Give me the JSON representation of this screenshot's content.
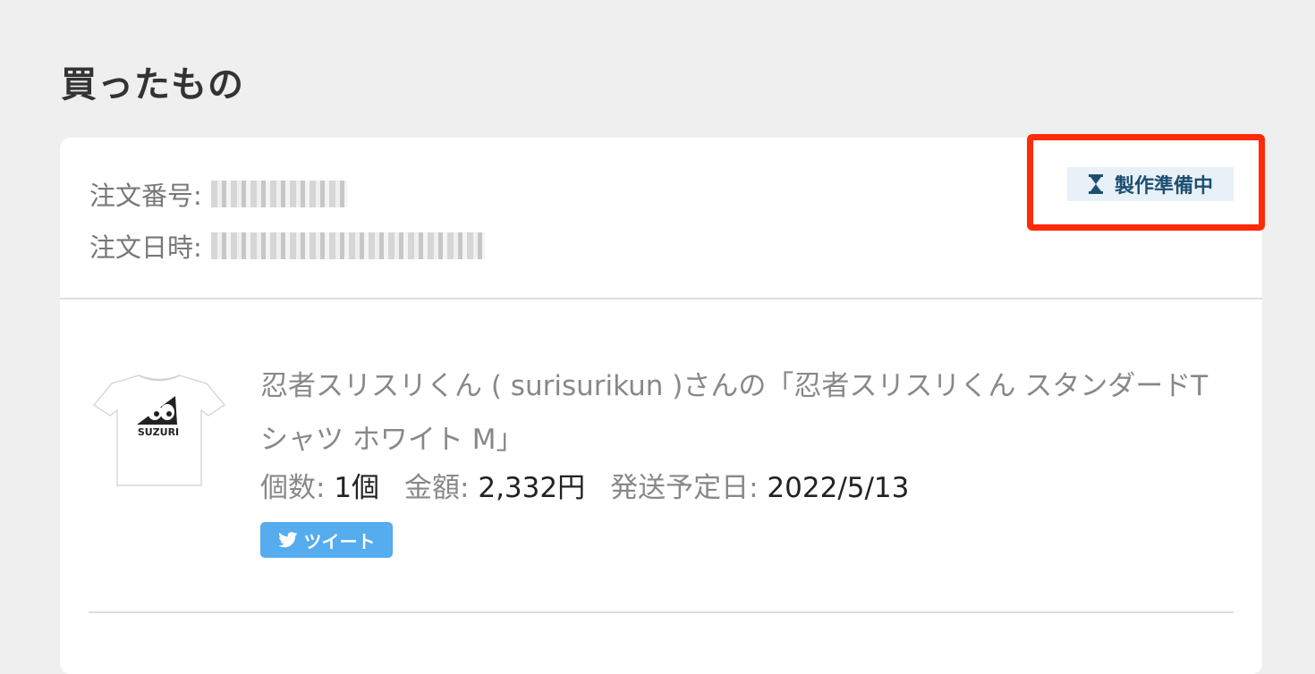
{
  "page": {
    "title": "買ったもの"
  },
  "order": {
    "number_label": "注文番号:",
    "date_label": "注文日時:",
    "status": "製作準備中"
  },
  "product": {
    "title": "忍者スリスリくん ( surisurikun )さんの「忍者スリスリくん スタンダードTシャツ ホワイト M」",
    "thumbnail_text": "SUZURI",
    "quantity_label": "個数:",
    "quantity_value": "1個",
    "price_label": "金額:",
    "price_value": "2,332円",
    "ship_label": "発送予定日:",
    "ship_value": "2022/5/13"
  },
  "actions": {
    "tweet_label": "ツイート"
  },
  "colors": {
    "tweet": "#55acee",
    "status_bg": "#e8f1f7",
    "highlight": "#ff2a06"
  },
  "icons": {
    "status": "hourglass-icon",
    "tweet": "twitter-bird-icon"
  }
}
